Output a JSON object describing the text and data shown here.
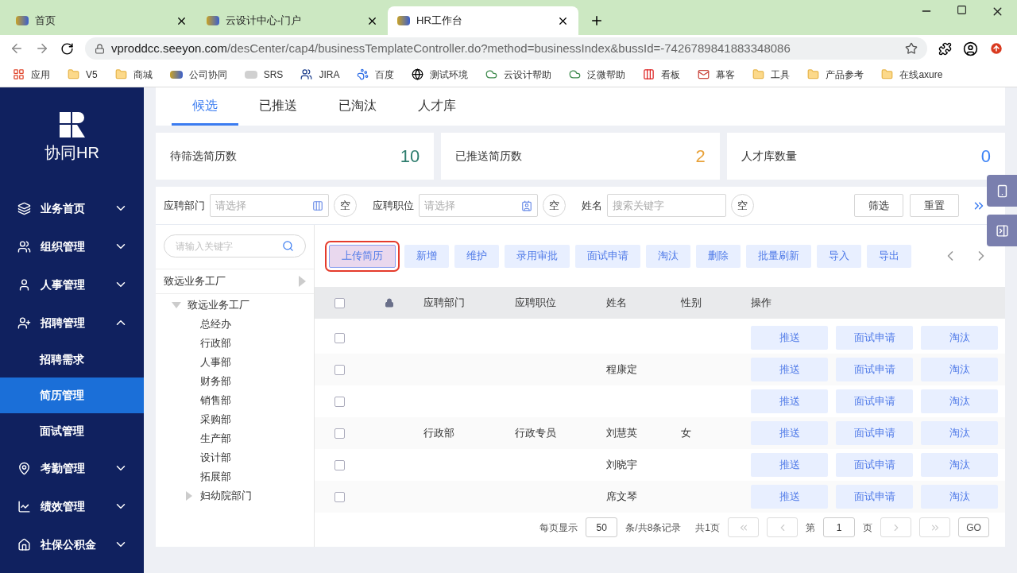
{
  "browser": {
    "tabs": [
      {
        "title": "首页",
        "selected": false
      },
      {
        "title": "云设计中心-门户",
        "selected": false
      },
      {
        "title": "HR工作台",
        "selected": true
      }
    ],
    "url_host": "vproddcc.seeyon.com",
    "url_path": "/desCenter/cap4/businessTemplateController.do?method=businessIndex&bussId=-7426789841883348086",
    "bookmarks": [
      {
        "label": "应用",
        "kind": "apps"
      },
      {
        "label": "V5",
        "kind": "folder"
      },
      {
        "label": "商城",
        "kind": "folder"
      },
      {
        "label": "公司协同",
        "kind": "a8"
      },
      {
        "label": "SRS",
        "kind": "abvs"
      },
      {
        "label": "JIRA",
        "kind": "jira"
      },
      {
        "label": "百度",
        "kind": "paw"
      },
      {
        "label": "测试环境",
        "kind": "globe"
      },
      {
        "label": "云设计帮助",
        "kind": "cloud"
      },
      {
        "label": "泛微帮助",
        "kind": "cloud"
      },
      {
        "label": "看板",
        "kind": "kb"
      },
      {
        "label": "幕客",
        "kind": "mail"
      },
      {
        "label": "工具",
        "kind": "folder"
      },
      {
        "label": "产品参考",
        "kind": "folder"
      },
      {
        "label": "在线axure",
        "kind": "folder"
      }
    ]
  },
  "sidebar": {
    "logo_text": "协同HR",
    "items": [
      {
        "label": "业务首页",
        "expanded": false
      },
      {
        "label": "组织管理",
        "expanded": false
      },
      {
        "label": "人事管理",
        "expanded": false
      },
      {
        "label": "招聘管理",
        "expanded": true,
        "children": [
          {
            "label": "招聘需求",
            "selected": false
          },
          {
            "label": "简历管理",
            "selected": true
          },
          {
            "label": "面试管理",
            "selected": false
          }
        ]
      },
      {
        "label": "考勤管理",
        "expanded": false
      },
      {
        "label": "绩效管理",
        "expanded": false
      },
      {
        "label": "社保公积金",
        "expanded": false
      }
    ]
  },
  "page_tabs": [
    {
      "label": "候选",
      "selected": true
    },
    {
      "label": "已推送",
      "selected": false
    },
    {
      "label": "已淘汰",
      "selected": false
    },
    {
      "label": "人才库",
      "selected": false
    }
  ],
  "stats": [
    {
      "label": "待筛选简历数",
      "value": "10",
      "color": "#2e7d6e"
    },
    {
      "label": "已推送简历数",
      "value": "2",
      "color": "#e8a23a"
    },
    {
      "label": "人才库数量",
      "value": "0",
      "color": "#3b82f6"
    }
  ],
  "filters": [
    {
      "label": "应聘部门",
      "placeholder": "请选择",
      "clear": "空",
      "kind": "dept"
    },
    {
      "label": "应聘职位",
      "placeholder": "请选择",
      "clear": "空",
      "kind": "card"
    },
    {
      "label": "姓名",
      "placeholder": "搜索关键字",
      "clear": "空",
      "kind": "text"
    }
  ],
  "filter_buttons": [
    "筛选",
    "重置"
  ],
  "tree": {
    "search_placeholder": "请输入关键字",
    "header": "致远业务工厂",
    "nodes": [
      {
        "label": "致远业务工厂",
        "expanded": true,
        "children": [
          {
            "label": "总经办"
          },
          {
            "label": "行政部"
          },
          {
            "label": "人事部"
          },
          {
            "label": "财务部"
          },
          {
            "label": "销售部"
          },
          {
            "label": "采购部"
          },
          {
            "label": "生产部"
          },
          {
            "label": "设计部"
          },
          {
            "label": "拓展部"
          },
          {
            "label": "妇幼院部门",
            "expanded": false
          }
        ]
      }
    ]
  },
  "toolbar": [
    {
      "label": "上传简历",
      "selected": true
    },
    {
      "label": "新增",
      "selected": false
    },
    {
      "label": "维护",
      "selected": false
    },
    {
      "label": "录用审批",
      "selected": false
    },
    {
      "label": "面试申请",
      "selected": false
    },
    {
      "label": "淘汰",
      "selected": false
    },
    {
      "label": "删除",
      "selected": false
    },
    {
      "label": "批量刷新",
      "selected": false
    },
    {
      "label": "导入",
      "selected": false
    },
    {
      "label": "导出",
      "selected": false
    }
  ],
  "table": {
    "all_checked": false,
    "columns": [
      "应聘部门",
      "应聘职位",
      "姓名",
      "性别",
      "操作"
    ],
    "rows": [
      {
        "checked": false,
        "cells": [
          "",
          "",
          "",
          ""
        ],
        "actions": [
          "推送",
          "面试申请",
          "淘汰"
        ]
      },
      {
        "checked": false,
        "cells": [
          "",
          "",
          "程康定",
          ""
        ],
        "actions": [
          "推送",
          "面试申请",
          "淘汰"
        ]
      },
      {
        "checked": false,
        "cells": [
          "",
          "",
          "",
          ""
        ],
        "actions": [
          "推送",
          "面试申请",
          "淘汰"
        ]
      },
      {
        "checked": false,
        "cells": [
          "行政部",
          "行政专员",
          "刘慧英",
          "女"
        ],
        "actions": [
          "推送",
          "面试申请",
          "淘汰"
        ]
      },
      {
        "checked": false,
        "cells": [
          "",
          "",
          "刘晓宇",
          ""
        ],
        "actions": [
          "推送",
          "面试申请",
          "淘汰"
        ]
      },
      {
        "checked": false,
        "cells": [
          "",
          "",
          "席文琴",
          ""
        ],
        "actions": [
          "推送",
          "面试申请",
          "淘汰"
        ]
      }
    ]
  },
  "pagination": {
    "per_page_label": "每页显示",
    "per_page": "50",
    "summary": "条/共8条记录",
    "pages": "共1页",
    "page_label": "第",
    "page": "1",
    "page_unit": "页",
    "go": "GO"
  }
}
